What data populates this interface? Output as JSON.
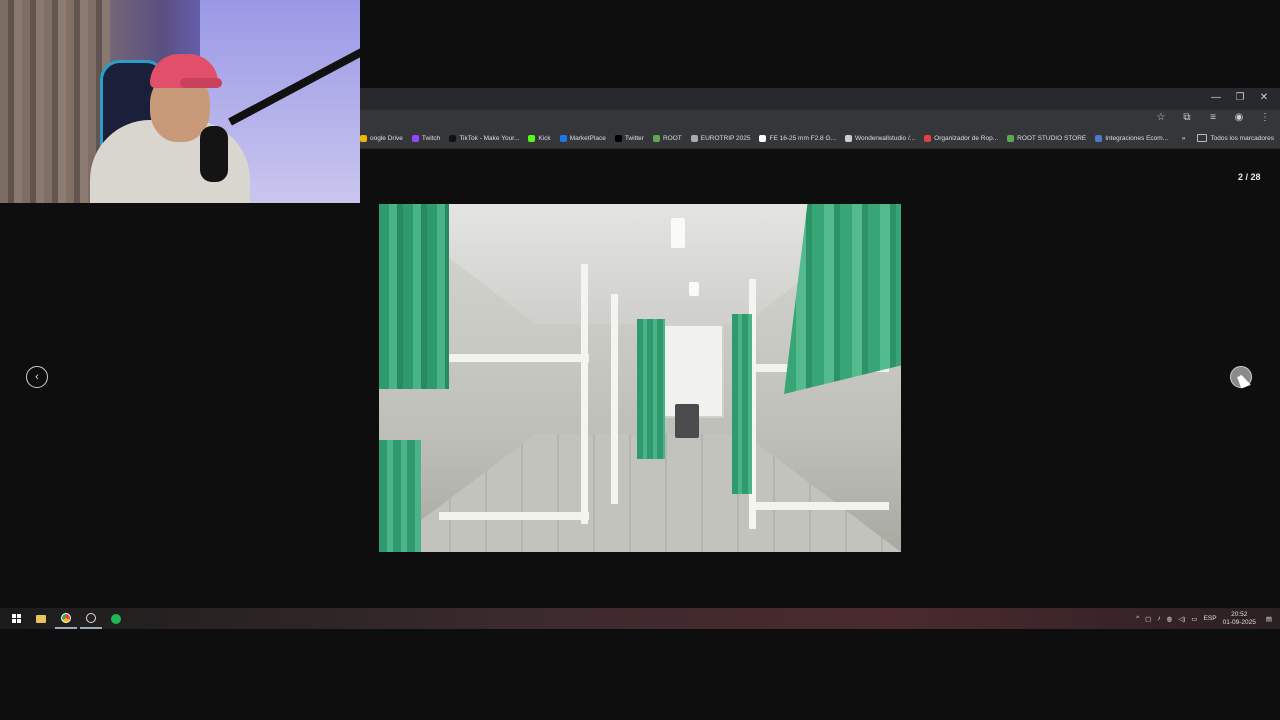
{
  "browser": {
    "window_controls": {
      "minimize": "—",
      "restore": "❐",
      "close": "✕"
    },
    "bookmarks": [
      {
        "label": "oogle Drive",
        "icon": "google-drive-icon",
        "color": "#f2b400"
      },
      {
        "label": "Twitch",
        "icon": "twitch-icon",
        "color": "#9146ff"
      },
      {
        "label": "TikTok - Make Your...",
        "icon": "tiktok-icon",
        "color": "#111111"
      },
      {
        "label": "Kick",
        "icon": "kick-icon",
        "color": "#53fc18"
      },
      {
        "label": "MarketPlace",
        "icon": "facebook-icon",
        "color": "#1877f2"
      },
      {
        "label": "Twitter",
        "icon": "x-icon",
        "color": "#000000"
      },
      {
        "label": "ROOT",
        "icon": "shopify-icon",
        "color": "#5fa84e"
      },
      {
        "label": "EUROTRIP 2025",
        "icon": "folder-icon",
        "color": "#aaaaaa"
      },
      {
        "label": "FE 16-25 mm F2.8 G...",
        "icon": "sony-icon",
        "color": "#ffffff"
      },
      {
        "label": "Wonderwallstudio /...",
        "icon": "page-icon",
        "color": "#cccccc"
      },
      {
        "label": "Organizador de Rop...",
        "icon": "cube-icon",
        "color": "#e04040"
      },
      {
        "label": "ROOT STUDIO STORE",
        "icon": "shopify-icon",
        "color": "#5fa84e"
      },
      {
        "label": "Integraciones Ecom...",
        "icon": "doc-icon",
        "color": "#4a7bd0"
      }
    ],
    "more_bookmarks": "»",
    "all_bookmarks": "Todos los marcadores"
  },
  "gallery": {
    "counter": "2 / 28",
    "prev_label": "‹",
    "next_label": "›"
  },
  "taskbar": {
    "language": "ESP",
    "time": "20:52",
    "date": "01-09-2025"
  }
}
